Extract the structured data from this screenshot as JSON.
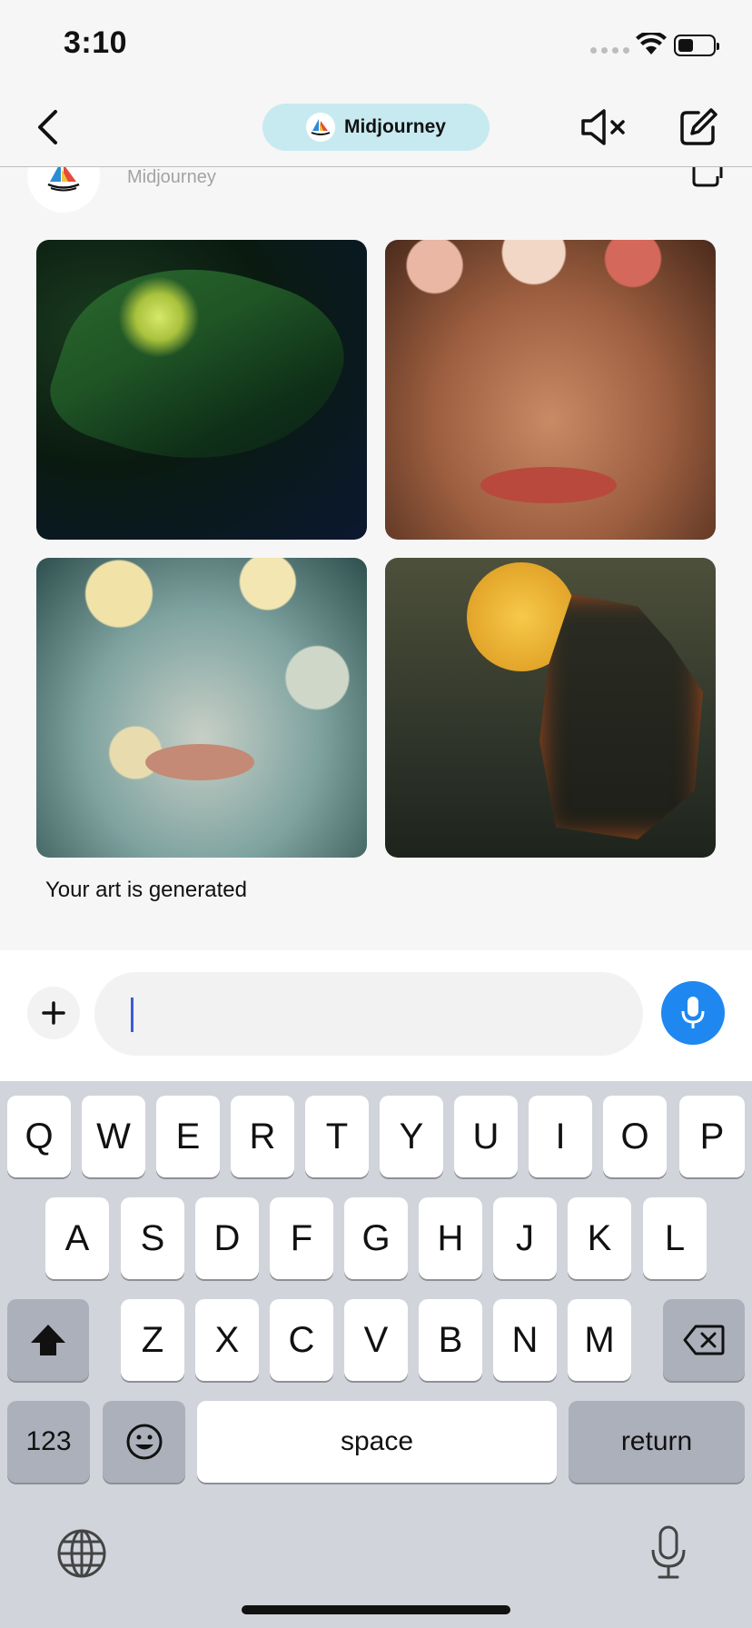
{
  "status_bar": {
    "time": "3:10"
  },
  "nav": {
    "bot_name": "Midjourney"
  },
  "message": {
    "sender": "Midjourney",
    "images": [
      {
        "name": "leaf-image"
      },
      {
        "name": "floral-face-image"
      },
      {
        "name": "flower-mask-image"
      },
      {
        "name": "moon-city-image"
      }
    ],
    "caption": "Your art is generated"
  },
  "input": {
    "placeholder": ""
  },
  "keyboard": {
    "row1": [
      "Q",
      "W",
      "E",
      "R",
      "T",
      "Y",
      "U",
      "I",
      "O",
      "P"
    ],
    "row2": [
      "A",
      "S",
      "D",
      "F",
      "G",
      "H",
      "J",
      "K",
      "L"
    ],
    "row3": [
      "Z",
      "X",
      "C",
      "V",
      "B",
      "N",
      "M"
    ],
    "numbers_label": "123",
    "space_label": "space",
    "return_label": "return"
  },
  "colors": {
    "pill": "#c7eaf1",
    "mic": "#1e88f0",
    "caret": "#3b5bdb"
  }
}
